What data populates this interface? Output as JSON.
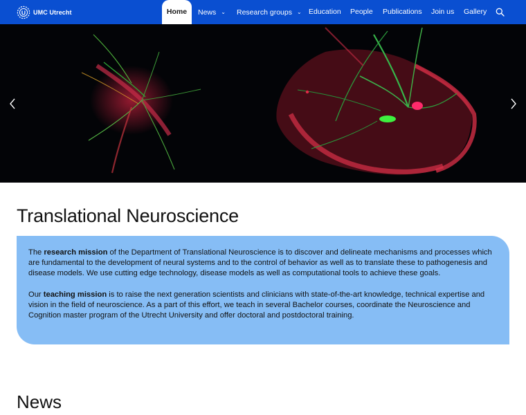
{
  "brand": {
    "logo_text": "UMC Utrecht"
  },
  "nav": {
    "home": "Home",
    "news": "News",
    "research_groups": "Research groups",
    "education": "Education",
    "people": "People",
    "publications": "Publications",
    "join_us": "Join us",
    "gallery": "Gallery"
  },
  "icons": {
    "logo": "umc-utrecht-logo-icon",
    "search": "search-icon",
    "chevron": "chevron-down-icon",
    "prev": "chevron-left-icon",
    "next": "chevron-right-icon"
  },
  "colors": {
    "nav_bg": "#0a4fd1",
    "mission_box_bg": "#86bdf5",
    "hero_bg": "#030407"
  },
  "page": {
    "title": "Translational Neuroscience"
  },
  "mission": {
    "p1_pre": "The ",
    "p1_bold": "research mission",
    "p1_post": " of the Department of Translational Neuroscience is to discover and delineate mechanisms and processes which are fundamental to the development of neural systems and to the control of behavior as well as to translate these to pathogenesis and disease models. We use cutting edge technology, disease models as well as computational tools to achieve these goals.",
    "p2_pre": "Our ",
    "p2_bold": "teaching mission",
    "p2_post": " is to raise the next generation scientists and clinicians with state-of-the-art knowledge, technical expertise and vision in the field of neuroscience. As a part of this effort, we teach in several Bachelor courses, coordinate the Neuroscience and Cognition master program of the Utrecht University and offer doctoral and postdoctoral training."
  },
  "news": {
    "title": "News"
  }
}
